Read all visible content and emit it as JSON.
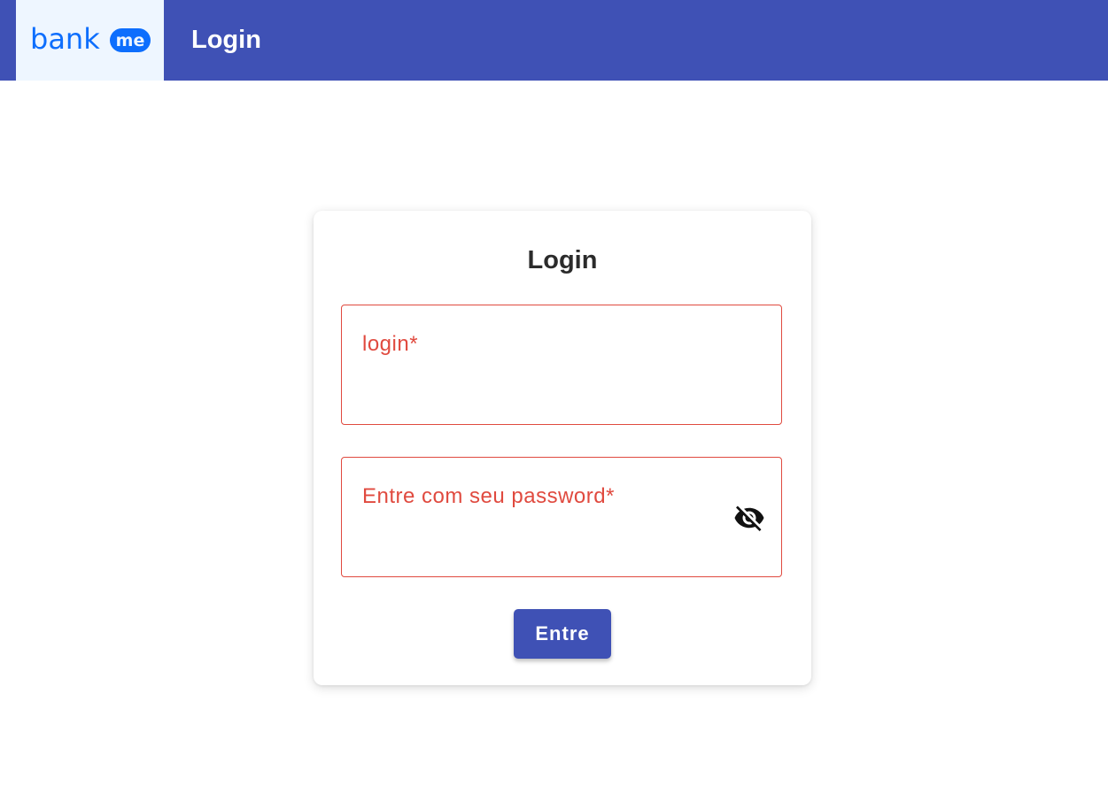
{
  "header": {
    "logo_text": "bankme",
    "title": "Login",
    "brand_color": "#3f51b5",
    "logo_color": "#0d6efd"
  },
  "login_card": {
    "title": "Login",
    "fields": {
      "login": {
        "label": "login*",
        "value": ""
      },
      "password": {
        "label": "Entre com seu password*",
        "value": "",
        "toggle_icon": "eye-off-icon"
      }
    },
    "submit_label": "Entre",
    "error_color": "#e04a3f"
  }
}
